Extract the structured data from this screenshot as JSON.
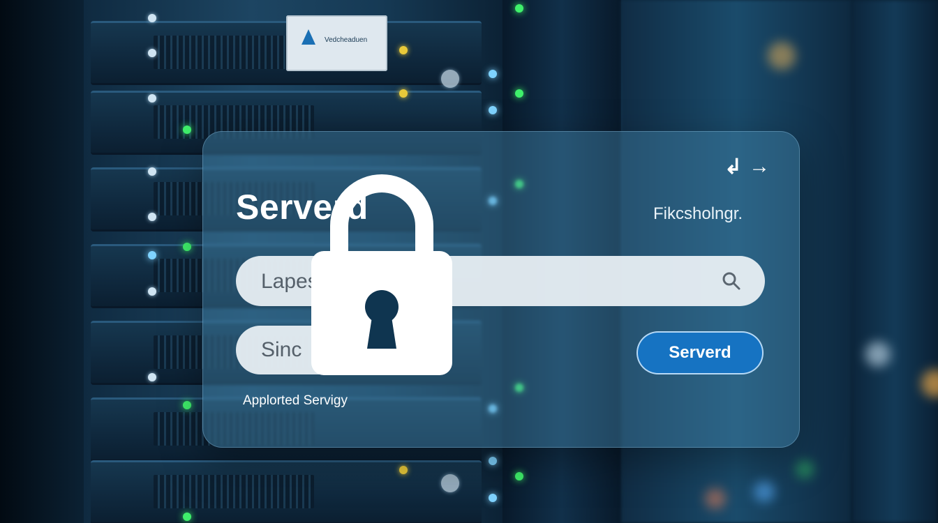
{
  "panel": {
    "title": "Serverd",
    "subtitle": "Fikcsholngr.",
    "top_icons": [
      "↲",
      "→"
    ],
    "search_value": "Lapeswordg",
    "second_field_value": "Sinc",
    "action_button": "Serverd",
    "footer_text": "Applorted Servigy"
  },
  "server_label": "Vedcheaduen",
  "icons": {
    "lock": "padlock-icon",
    "search": "search-icon",
    "refresh": "return-icon",
    "forward": "arrow-right-icon"
  },
  "colors": {
    "panel": "#4687af",
    "button": "#1673c2",
    "led_yellow": "#e8c93a",
    "led_green": "#3ff06b",
    "led_blue": "#7fd3ff"
  }
}
